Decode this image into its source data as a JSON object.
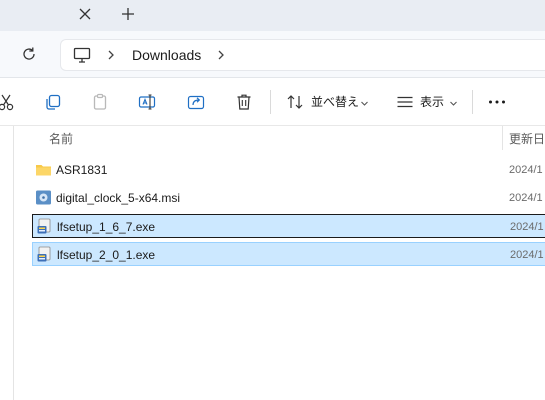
{
  "titlebar": {
    "close_tab_label": "Close tab",
    "new_tab_label": "New tab"
  },
  "address": {
    "breadcrumbs": [
      "Downloads"
    ]
  },
  "toolbar": {
    "sort_label": "並べ替え",
    "view_label": "表示"
  },
  "columns": {
    "name": "名前",
    "date": "更新日"
  },
  "files": [
    {
      "name": "ASR1831",
      "date": "2024/1",
      "icon": "folder-icon",
      "selected": false
    },
    {
      "name": "digital_clock_5-x64.msi",
      "date": "2024/1",
      "icon": "msi-installer-icon",
      "selected": false
    },
    {
      "name": "lfsetup_1_6_7.exe",
      "date": "2024/1",
      "icon": "exe-setup-icon",
      "selected": true
    },
    {
      "name": "lfsetup_2_0_1.exe",
      "date": "2024/1",
      "icon": "exe-setup-icon",
      "selected": true
    }
  ],
  "colors": {
    "selection_bg": "#cce8ff",
    "selection_border": "#99d1ff",
    "tabstrip_bg": "#e9edf3",
    "accent": "#005fb8"
  }
}
